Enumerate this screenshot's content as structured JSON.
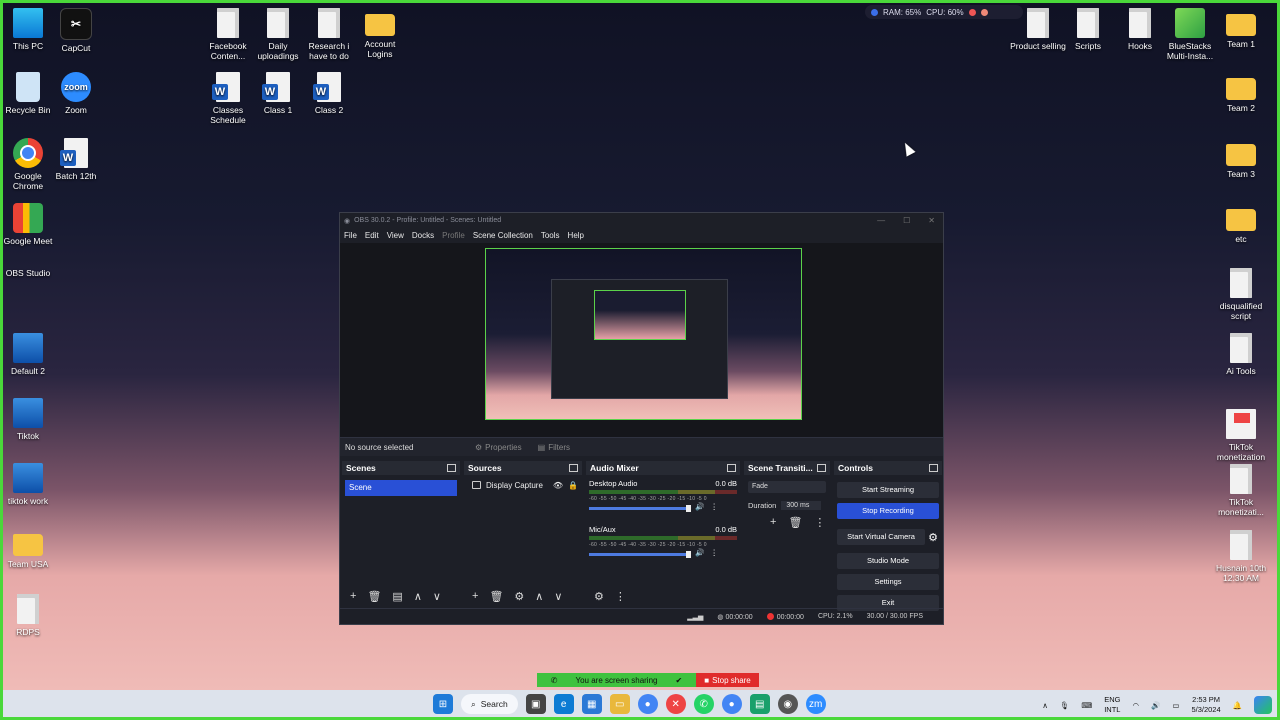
{
  "desktop": {
    "left_icons": [
      {
        "label": "This PC",
        "type": "pc"
      },
      {
        "label": "CapCut",
        "type": "capcut"
      },
      {
        "label": "Recycle Bin",
        "type": "bin"
      },
      {
        "label": "Zoom",
        "type": "zoom"
      },
      {
        "label": "Google Chrome",
        "type": "chrome"
      },
      {
        "label": "Batch 12th",
        "type": "word"
      },
      {
        "label": "Google Meet",
        "type": "meet"
      },
      {
        "label": "OBS Studio",
        "type": "obs"
      },
      {
        "label": "Default 2",
        "type": "rdp"
      },
      {
        "label": "Tiktok",
        "type": "rdp"
      },
      {
        "label": "tiktok work",
        "type": "rdp"
      },
      {
        "label": "Team USA",
        "type": "folder"
      },
      {
        "label": "RDPS",
        "type": "doc"
      }
    ],
    "top_icons": [
      {
        "label": "Facebook Conten...",
        "type": "doc"
      },
      {
        "label": "Daily uploadings",
        "type": "doc"
      },
      {
        "label": "Research i have to do",
        "type": "doc"
      },
      {
        "label": "Account Logins",
        "type": "folder"
      },
      {
        "label": "Classes Schedule",
        "type": "word"
      },
      {
        "label": "Class 1",
        "type": "word"
      },
      {
        "label": "Class 2",
        "type": "word"
      }
    ],
    "right_icons": [
      {
        "label": "Product selling",
        "type": "doc"
      },
      {
        "label": "Scripts",
        "type": "doc"
      },
      {
        "label": "Hooks",
        "type": "doc"
      },
      {
        "label": "BlueStacks Multi-Insta...",
        "type": "bluestacks"
      },
      {
        "label": "Team 1",
        "type": "folder"
      },
      {
        "label": "Team 2",
        "type": "folder"
      },
      {
        "label": "Team 3",
        "type": "folder"
      },
      {
        "label": "etc",
        "type": "folder"
      },
      {
        "label": "disqualified script",
        "type": "doc"
      },
      {
        "label": "Ai Tools",
        "type": "doc"
      },
      {
        "label": "TikTok monetization",
        "type": "tiktok"
      },
      {
        "label": "TikTok monetizati...",
        "type": "doc"
      },
      {
        "label": "Husnain 10th 12:30 AM",
        "type": "doc"
      }
    ],
    "system_widget": {
      "ram": "RAM: 65%",
      "cpu": "CPU: 60%"
    }
  },
  "obs": {
    "title": "OBS 30.0.2 - Profile: Untitled - Scenes: Untitled",
    "menu": [
      "File",
      "Edit",
      "View",
      "Docks",
      "Profile",
      "Scene Collection",
      "Tools",
      "Help"
    ],
    "source_bar": {
      "status": "No source selected",
      "properties": "Properties",
      "filters": "Filters"
    },
    "scenes": {
      "title": "Scenes",
      "items": [
        "Scene"
      ]
    },
    "sources": {
      "title": "Sources",
      "items": [
        "Display Capture"
      ]
    },
    "mixer": {
      "title": "Audio Mixer",
      "channels": [
        {
          "name": "Desktop Audio",
          "level": "0.0 dB"
        },
        {
          "name": "Mic/Aux",
          "level": "0.0 dB"
        }
      ],
      "scale": "-60 -55 -50 -45 -40 -35 -30 -25 -20 -15 -10 -5 0"
    },
    "transitions": {
      "title": "Scene Transiti...",
      "selected": "Fade",
      "duration_label": "Duration",
      "duration_value": "300 ms"
    },
    "controls": {
      "title": "Controls",
      "start_streaming": "Start Streaming",
      "stop_recording": "Stop Recording",
      "start_virtual_camera": "Start Virtual Camera",
      "studio_mode": "Studio Mode",
      "settings": "Settings",
      "exit": "Exit"
    },
    "status": {
      "stream_time": "00:00:00",
      "rec_time": "00:00:00",
      "cpu": "CPU: 2.1%",
      "fps": "30.00 / 30.00 FPS"
    }
  },
  "share_bar": {
    "text": "You are screen sharing",
    "stop": "Stop share"
  },
  "taskbar": {
    "search": "Search",
    "lang_top": "ENG",
    "lang_bottom": "INTL",
    "time": "2:53 PM",
    "date": "5/3/2024"
  },
  "colors": {
    "accent": "#2950d6",
    "share_green": "#3fc23f",
    "stop_red": "#e02b2b",
    "frame": "#4ad83a"
  }
}
